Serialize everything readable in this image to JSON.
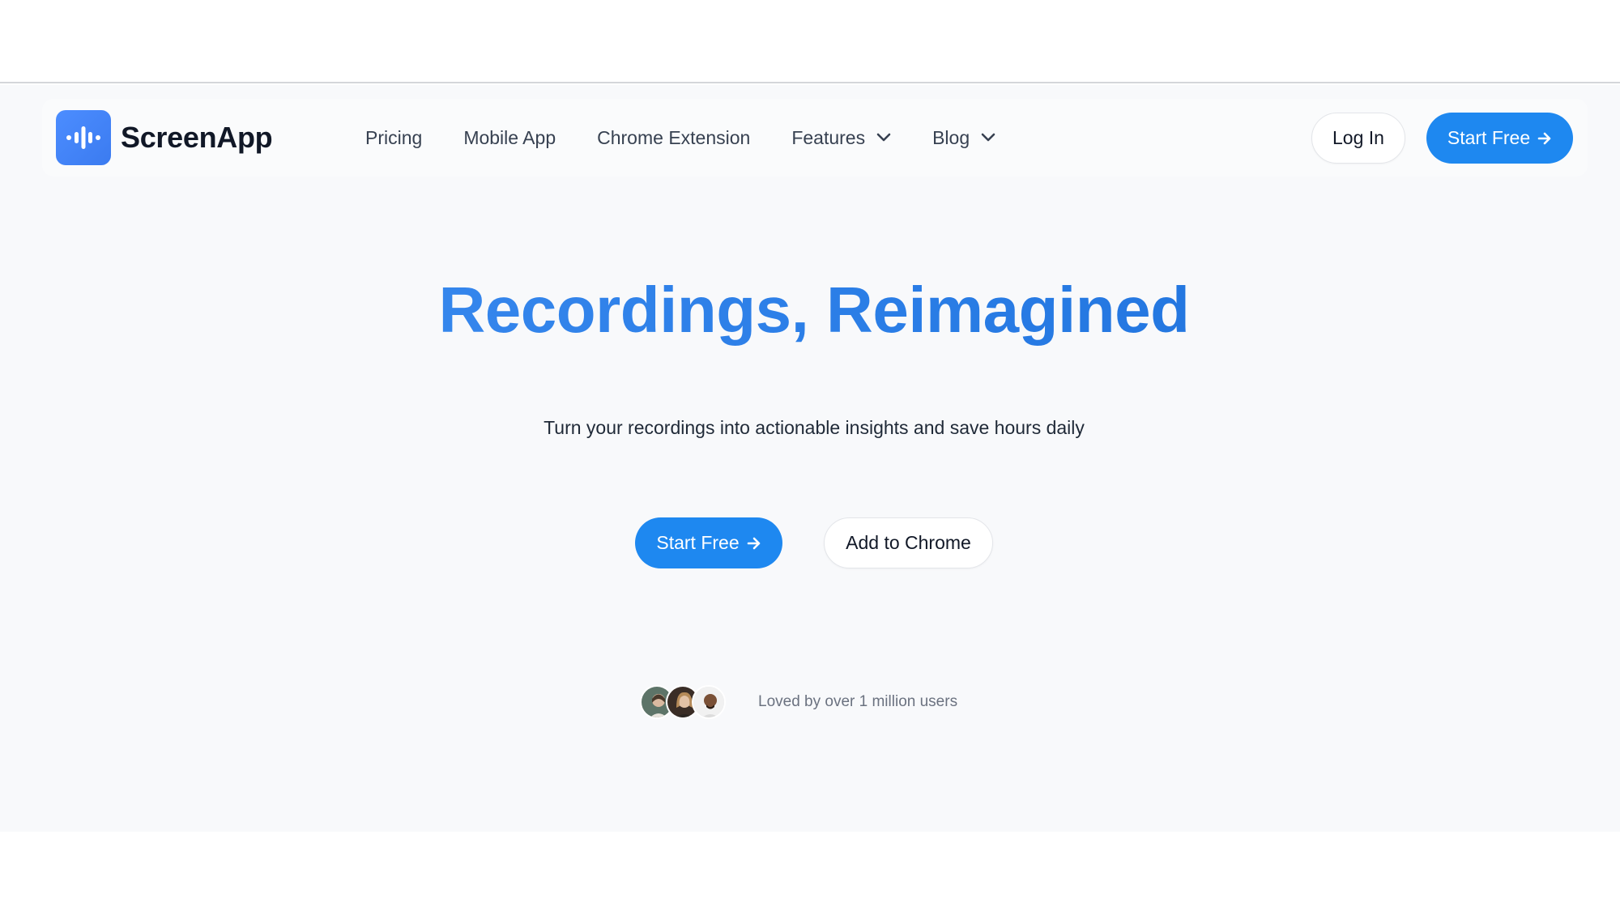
{
  "brand": {
    "name": "ScreenApp",
    "accent": "#1e88f0",
    "logo_icon": "audio-wave-icon"
  },
  "nav": {
    "items": [
      {
        "label": "Pricing",
        "dropdown": false
      },
      {
        "label": "Mobile App",
        "dropdown": false
      },
      {
        "label": "Chrome Extension",
        "dropdown": false
      },
      {
        "label": "Features",
        "dropdown": true
      },
      {
        "label": "Blog",
        "dropdown": true
      }
    ],
    "login_label": "Log In",
    "start_label": "Start Free"
  },
  "hero": {
    "title": "Recordings, Reimagined",
    "subtitle": "Turn your recordings into actionable insights and save hours daily",
    "primary_cta": "Start Free",
    "secondary_cta": "Add to Chrome"
  },
  "social_proof": {
    "text": "Loved by over 1 million users",
    "avatar_count": 3
  }
}
